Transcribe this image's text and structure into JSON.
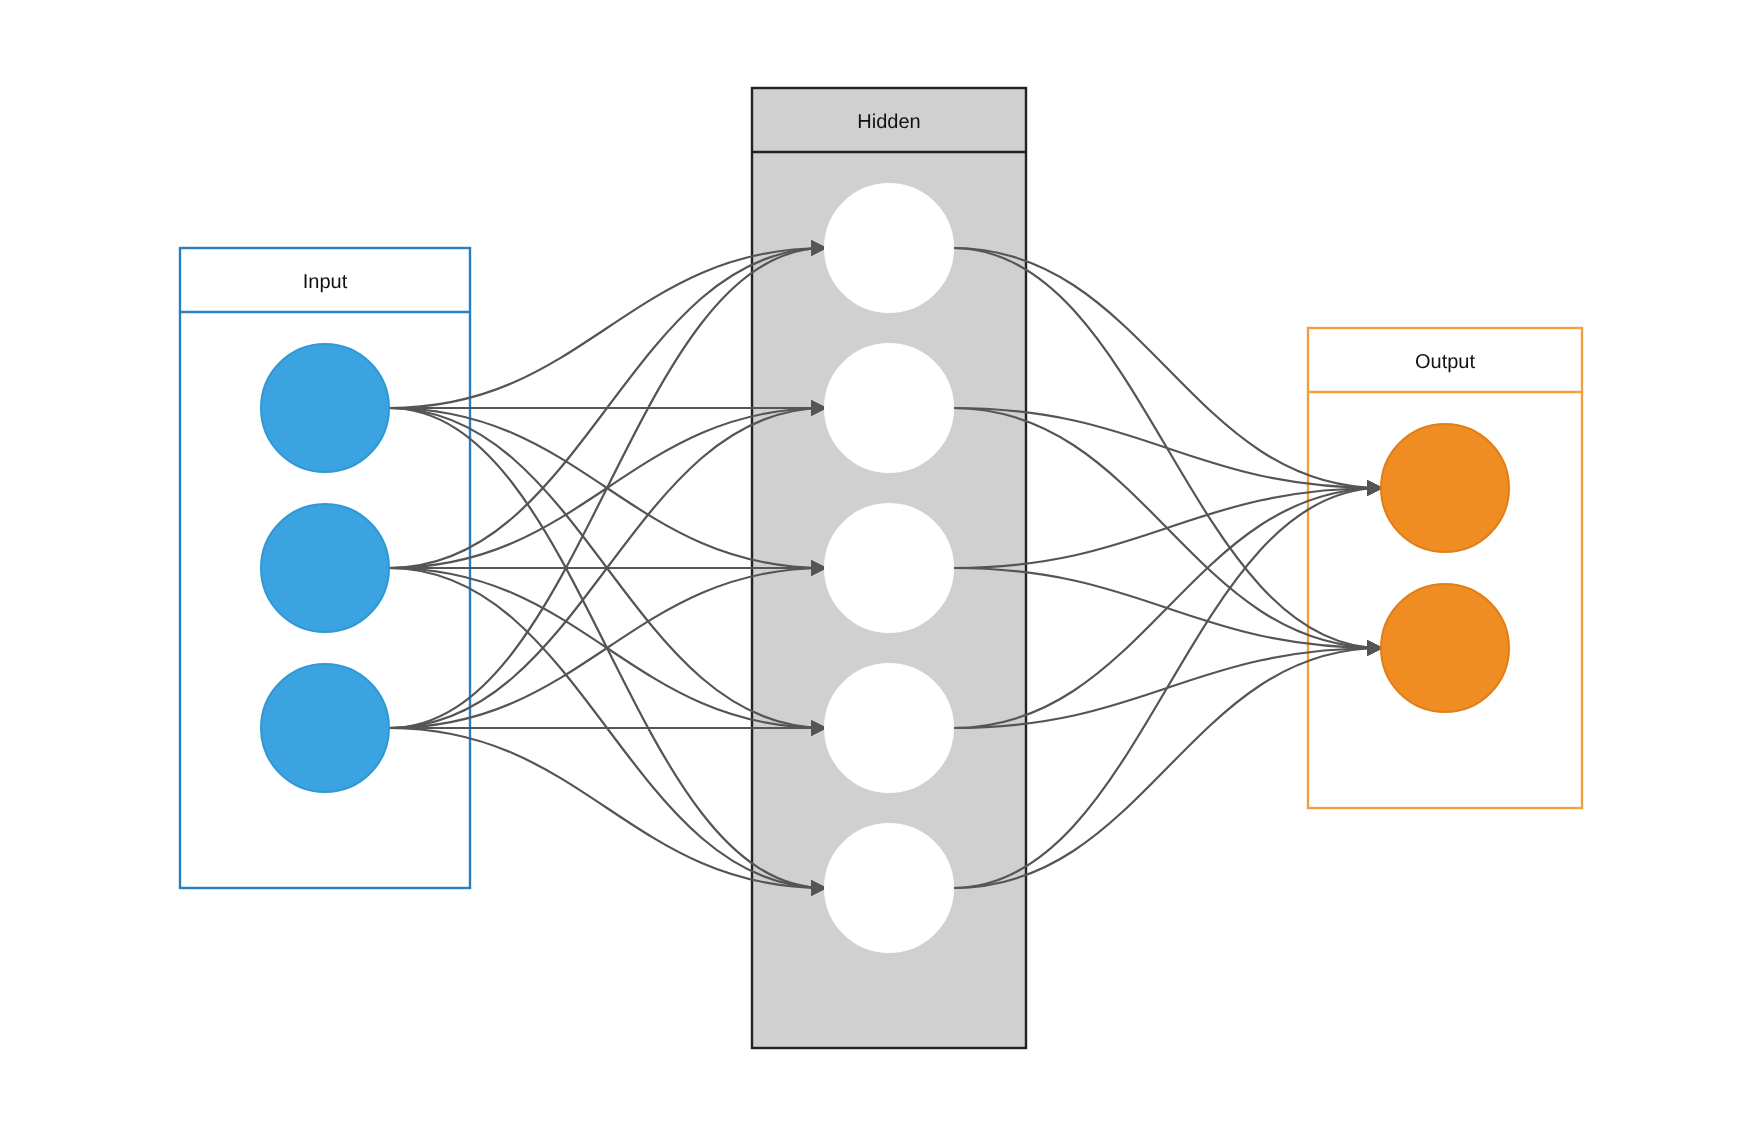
{
  "layers": [
    {
      "label": "Input",
      "kind": "input",
      "color": "#3aa3e0",
      "nodes": [
        {
          "kind": "neuron"
        },
        {
          "kind": "neuron"
        },
        {
          "kind": "neuron"
        }
      ]
    },
    {
      "label": "Hidden",
      "kind": "hidden",
      "color": "#ffffff",
      "nodes": [
        {
          "kind": "neuron"
        },
        {
          "kind": "neuron"
        },
        {
          "kind": "neuron"
        },
        {
          "kind": "neuron"
        },
        {
          "kind": "neuron"
        }
      ]
    },
    {
      "label": "Output",
      "kind": "output",
      "color": "#ef8c22",
      "nodes": [
        {
          "kind": "neuron"
        },
        {
          "kind": "neuron"
        }
      ]
    }
  ]
}
